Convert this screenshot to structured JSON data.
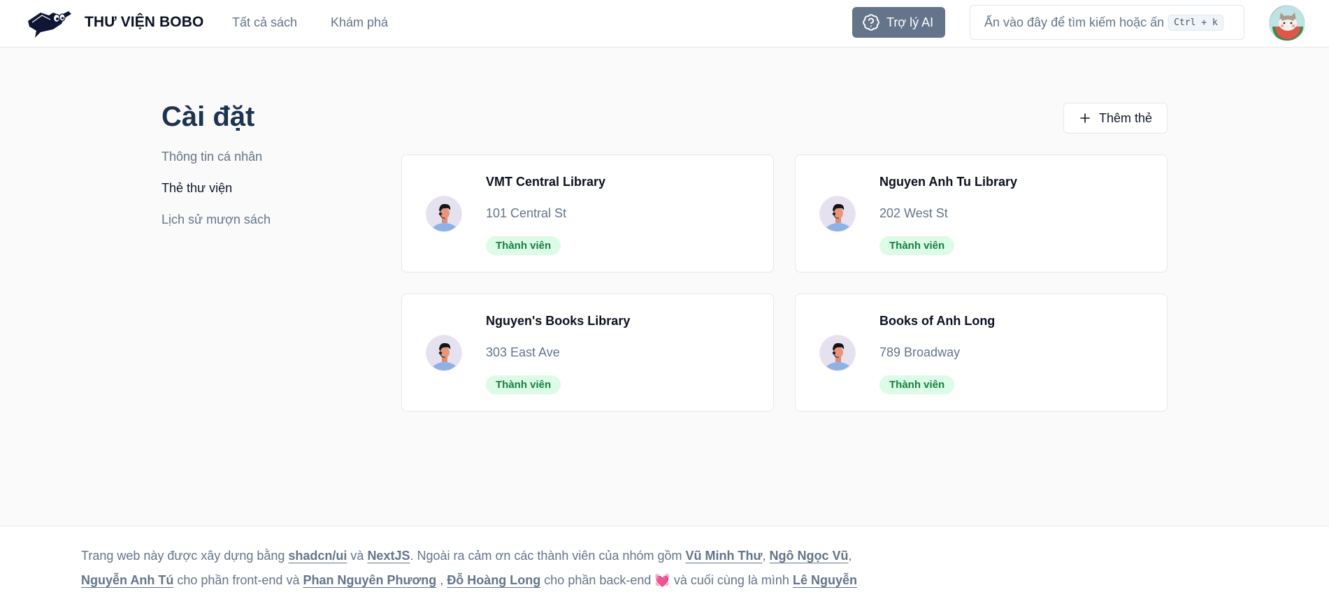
{
  "header": {
    "brand": "THƯ VIỆN BOBO",
    "nav": [
      "Tất cả sách",
      "Khám phá"
    ],
    "ai_button": "Trợ lý AI",
    "search_placeholder": "Ấn vào đây để tìm kiếm hoặc ấn",
    "search_shortcut": "Ctrl + k"
  },
  "page": {
    "title": "Cài đặt",
    "sidebar": [
      {
        "label": "Thông tin cá nhân",
        "active": false
      },
      {
        "label": "Thẻ thư viện",
        "active": true
      },
      {
        "label": "Lịch sử mượn sách",
        "active": false
      }
    ],
    "add_card_button": "Thêm thẻ"
  },
  "cards": [
    {
      "name": "VMT Central Library",
      "address": "101 Central St",
      "status": "Thành viên"
    },
    {
      "name": "Nguyen Anh Tu Library",
      "address": "202 West St",
      "status": "Thành viên"
    },
    {
      "name": "Nguyen's Books Library",
      "address": "303 East Ave",
      "status": "Thành viên"
    },
    {
      "name": "Books of Anh Long",
      "address": "789 Broadway",
      "status": "Thành viên"
    }
  ],
  "footer": {
    "t1": "Trang web này được xây dựng bằng ",
    "l_shadcn": "shadcn/ui",
    "t2": " và ",
    "l_next": "NextJS",
    "t3": ". Ngoài ra cảm ơn các thành viên của nhóm gồm ",
    "l_thu": "Vũ Minh Thư",
    "t4": ", ",
    "l_vu": "Ngô Ngọc Vũ",
    "t5": ",",
    "l_tu": "Nguyễn Anh Tú",
    "t6": " cho phần front-end và ",
    "l_phuong": "Phan Nguyên Phương",
    "t7": " , ",
    "l_long": "Đỗ Hoàng Long",
    "t8": " cho phần back-end ",
    "heart": "💓",
    "t9": " và cuối cùng là mình ",
    "l_le": "Lê Nguyễn"
  },
  "colors": {
    "accent": "#64748b",
    "badge_bg": "#dcfce7",
    "badge_text": "#15803d",
    "title": "#1e3350"
  }
}
